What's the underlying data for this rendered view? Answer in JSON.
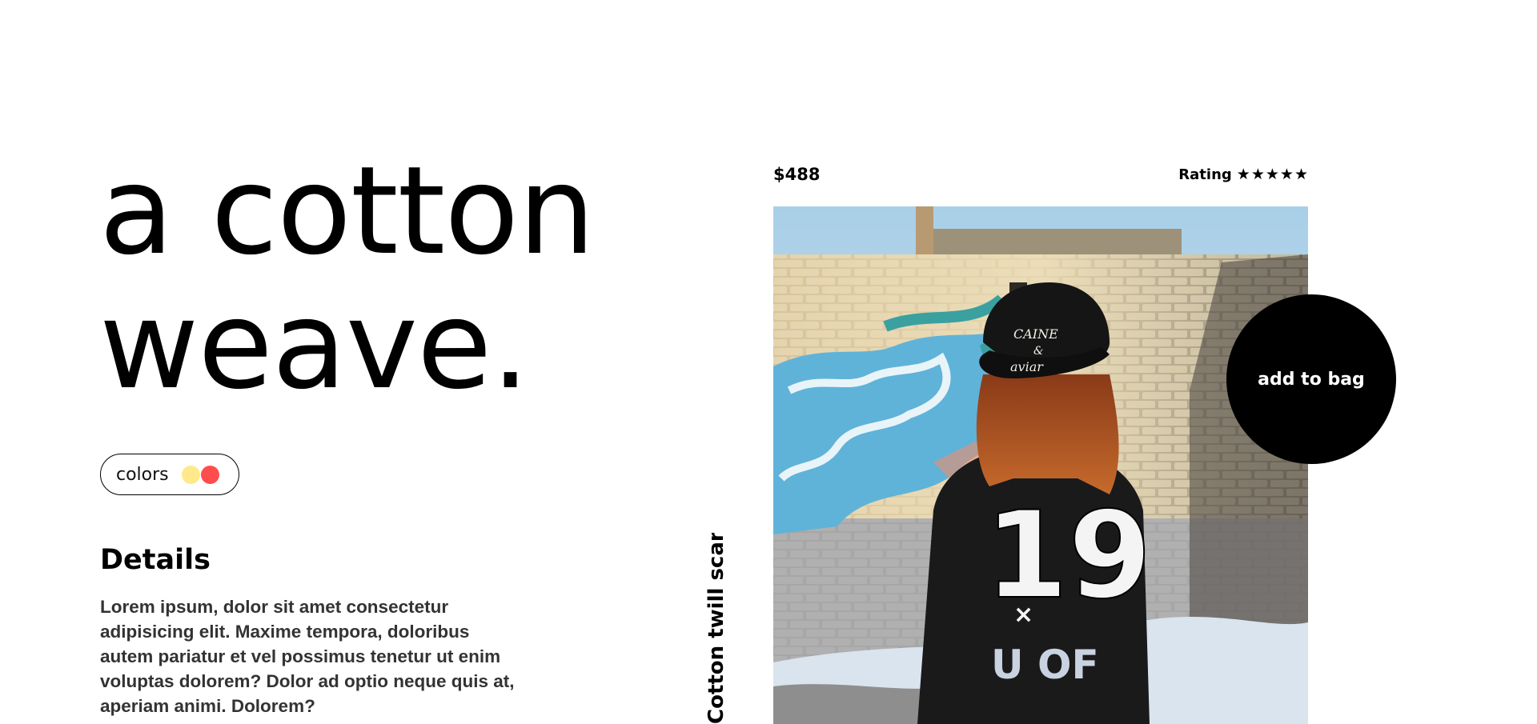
{
  "hero": {
    "line1": "a cotton",
    "line2": "weave."
  },
  "colors": {
    "label": "colors",
    "swatches": [
      "#ffe98a",
      "#ff4d4d"
    ]
  },
  "details": {
    "title": "Details",
    "body": "Lorem ipsum, dolor sit amet consectetur adipisicing elit. Maxime tempora, doloribus autem pariatur et vel possimus tenetur ut enim voluptas dolorem? Dolor ad optio neque quis at, aperiam animi. Dolorem?"
  },
  "product": {
    "name": "Cotton twill scarf",
    "price": "$488",
    "rating_label": "Rating",
    "rating_stars": 5,
    "star_glyph": "★",
    "image_icon": "product-photo",
    "add_to_bag_label": "add to bag"
  }
}
